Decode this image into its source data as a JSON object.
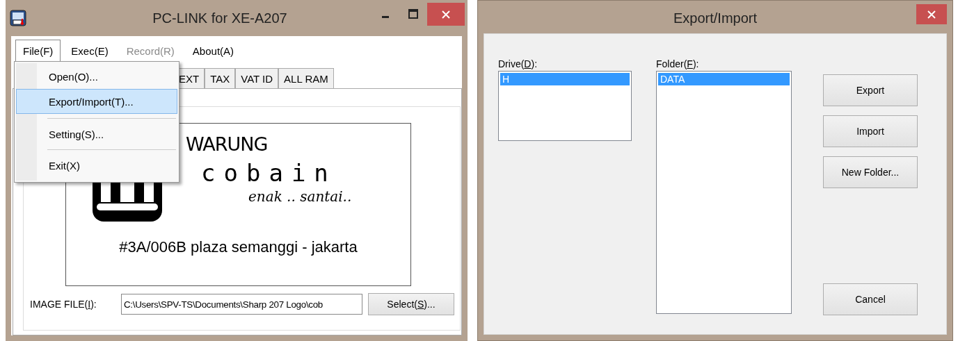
{
  "app_window": {
    "title": "PC-LINK for XE-A207",
    "menu": [
      {
        "label": "File(F)",
        "selected": true,
        "disabled": false
      },
      {
        "label": "Exec(E)",
        "selected": false,
        "disabled": false
      },
      {
        "label": "Record(R)",
        "selected": false,
        "disabled": true
      },
      {
        "label": "About(A)",
        "selected": false,
        "disabled": false
      }
    ],
    "tabs": [
      {
        "label": "EXT"
      },
      {
        "label": "TAX"
      },
      {
        "label": "VAT ID"
      },
      {
        "label": "ALL RAM"
      }
    ],
    "logo_preview": {
      "lines": [
        {
          "kind": "title",
          "text": "WARUNG"
        },
        {
          "kind": "name",
          "text": "cobain"
        },
        {
          "kind": "tagline",
          "text": "enak .. santai.."
        },
        {
          "kind": "address",
          "text": "#3A/006B plaza semanggi - jakarta"
        }
      ]
    },
    "image_file": {
      "label_before": "IMAGE FILE(",
      "access_key": "I",
      "label_after": "):",
      "value": "C:\\Users\\SPV-TS\\Documents\\Sharp 207 Logo\\cob",
      "button": {
        "label_before": "Select(",
        "access_key": "S",
        "label_after": ")..."
      }
    },
    "file_menu": {
      "items": [
        {
          "kind": "item",
          "label": "Open(O)...",
          "selected": false
        },
        {
          "kind": "item",
          "label": "Export/Import(T)...",
          "selected": true
        },
        {
          "kind": "separator"
        },
        {
          "kind": "item",
          "label": "Setting(S)...",
          "selected": false
        },
        {
          "kind": "separator"
        },
        {
          "kind": "item",
          "label": "Exit(X)",
          "selected": false
        }
      ]
    }
  },
  "dialog": {
    "title": "Export/Import",
    "drive": {
      "label_before": "Drive(",
      "access_key": "D",
      "label_after": "):",
      "items": [
        {
          "label": "H",
          "selected": true
        }
      ]
    },
    "folder": {
      "label_before": "Folder(",
      "access_key": "F",
      "label_after": "):",
      "items": [
        {
          "label": "DATA",
          "selected": true
        }
      ]
    },
    "buttons": [
      {
        "label": "Export",
        "kind": "action"
      },
      {
        "label": "Import",
        "kind": "action"
      },
      {
        "label": "New Folder...",
        "kind": "action"
      },
      {
        "label": "Cancel",
        "kind": "cancel"
      }
    ]
  }
}
